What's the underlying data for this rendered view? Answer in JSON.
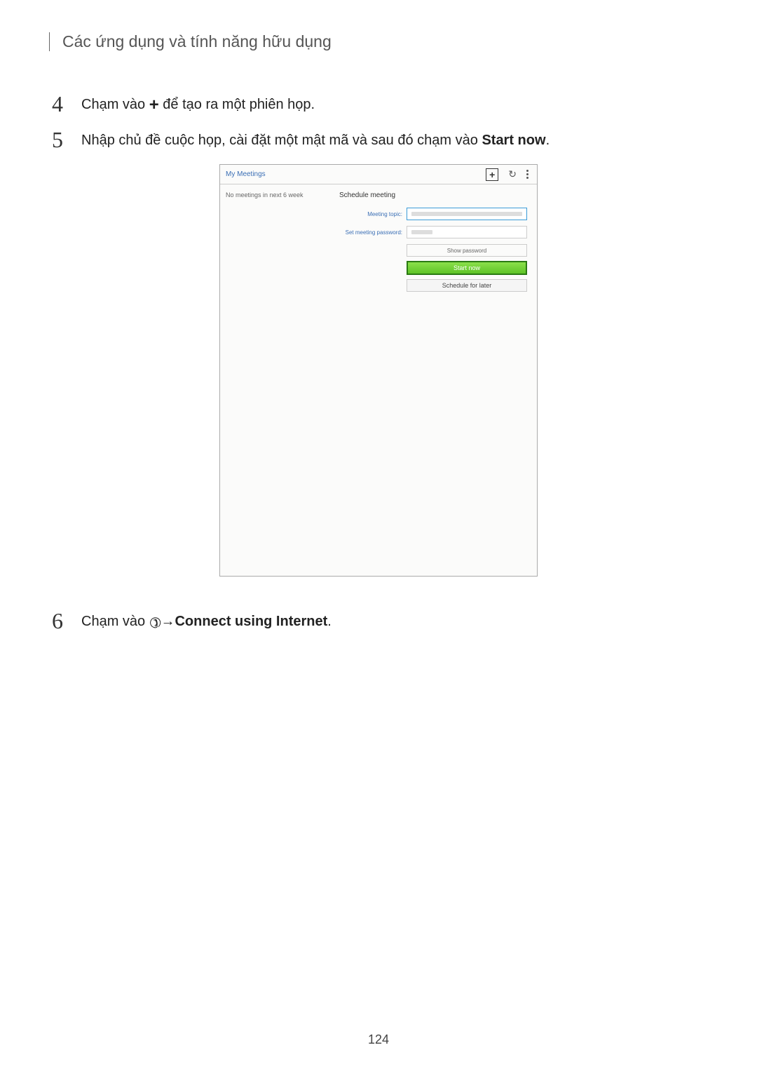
{
  "header": {
    "title": "Các ứng dụng và tính năng hữu dụng"
  },
  "steps": {
    "s4": {
      "num": "4",
      "pre": "Chạm vào ",
      "post": " để tạo ra một phiên họp."
    },
    "s5": {
      "num": "5",
      "text_pre": "Nhập chủ đề cuộc họp, cài đặt một mật mã và sau đó chạm vào ",
      "bold": "Start now",
      "text_post": "."
    },
    "s6": {
      "num": "6",
      "pre": "Chạm vào ",
      "arrow": " → ",
      "bold": "Connect using Internet",
      "post": "."
    }
  },
  "screenshot": {
    "topbar_title": "My Meetings",
    "left_text": "No meetings in next 6 week",
    "panel_title": "Schedule meeting",
    "label_topic": "Meeting topic:",
    "label_password": "Set meeting password:",
    "show_password": "Show password",
    "start_now": "Start now",
    "schedule_later": "Schedule for later"
  },
  "page_number": "124"
}
